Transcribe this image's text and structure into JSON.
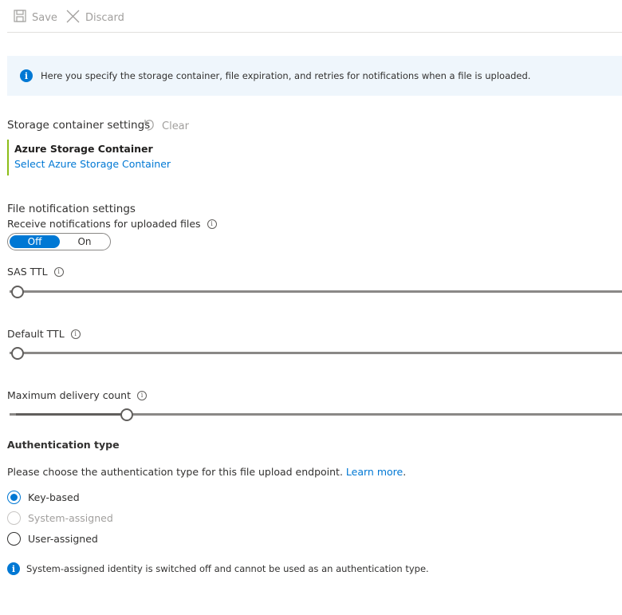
{
  "toolbar": {
    "save_label": "Save",
    "discard_label": "Discard"
  },
  "banner": {
    "text": "Here you specify the storage container, file expiration, and retries for notifications when a file is uploaded."
  },
  "storage": {
    "section_title": "Storage container settings",
    "clear_label": "Clear",
    "container_title": "Azure Storage Container",
    "container_link": "Select Azure Storage Container"
  },
  "notifications": {
    "section_title": "File notification settings",
    "receive_label": "Receive notifications for uploaded files",
    "toggle": {
      "off_label": "Off",
      "on_label": "On",
      "value": "Off"
    }
  },
  "sliders": {
    "sas_ttl": {
      "label": "SAS TTL",
      "level": 0.0
    },
    "default_ttl": {
      "label": "Default TTL",
      "level": 0.0
    },
    "max_delivery": {
      "label": "Maximum delivery count",
      "level": 0.18
    }
  },
  "auth": {
    "title": "Authentication type",
    "description": "Please choose the authentication type for this file upload endpoint.",
    "learn_more": "Learn more",
    "options": [
      {
        "label": "Key-based",
        "checked": true,
        "disabled": false
      },
      {
        "label": "System-assigned",
        "checked": false,
        "disabled": true
      },
      {
        "label": "User-assigned",
        "checked": false,
        "disabled": false
      }
    ],
    "note": "System-assigned identity is switched off and cannot be used as an authentication type."
  },
  "colors": {
    "accent": "#0078d4",
    "container_border": "#8cbd18",
    "banner_bg": "#eff6fc"
  }
}
